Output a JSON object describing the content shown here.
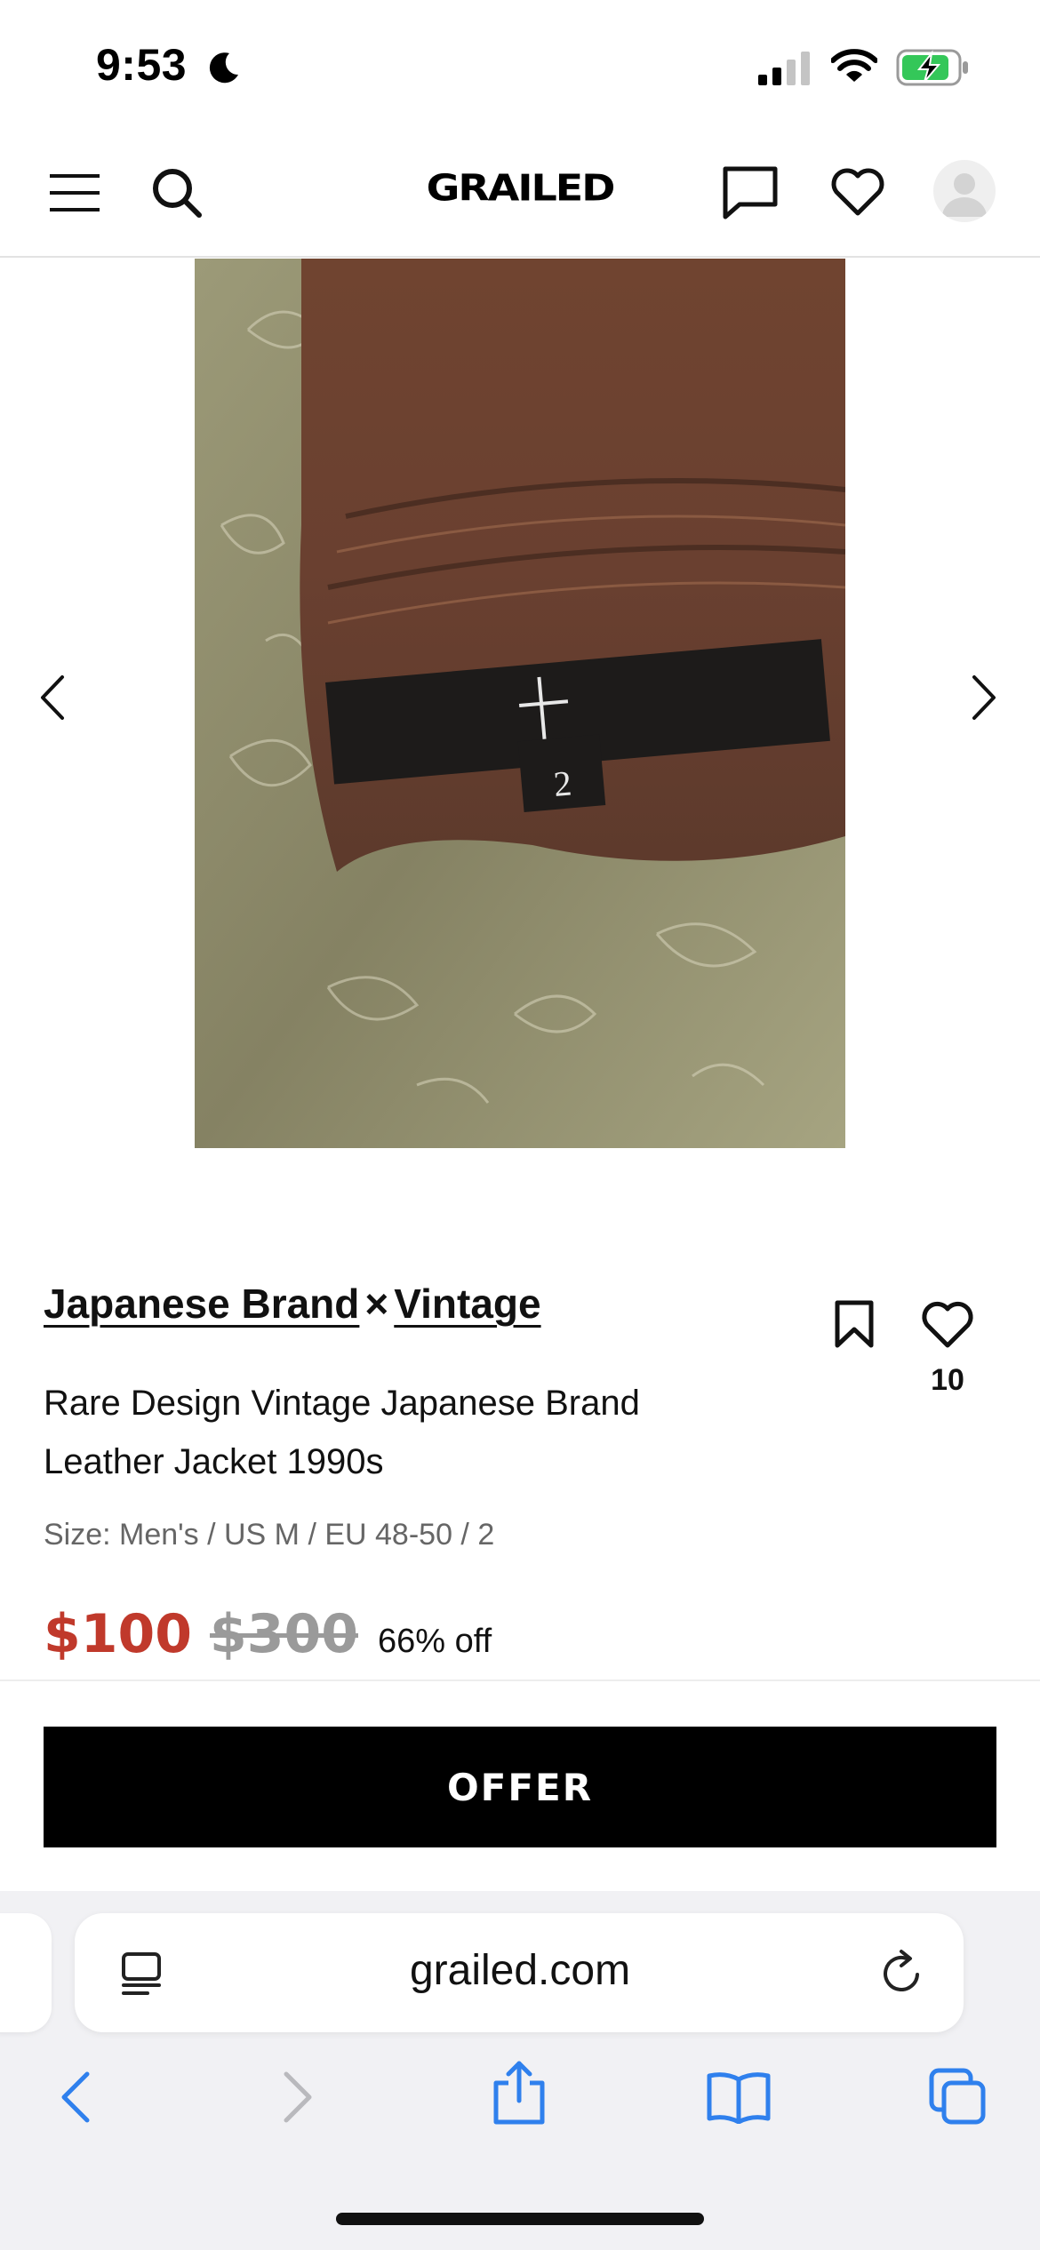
{
  "status_bar": {
    "time": "9:53",
    "icons": [
      "moon-icon",
      "cellular-signal-icon",
      "wifi-icon",
      "battery-charging-icon"
    ]
  },
  "header": {
    "logo": "GRAILED",
    "icons": [
      "menu-icon",
      "search-icon",
      "messages-icon",
      "favorites-heart-icon",
      "profile-avatar-icon"
    ]
  },
  "gallery": {
    "tag_number": "2",
    "icons": [
      "chevron-left-icon",
      "chevron-right-icon"
    ]
  },
  "product": {
    "brand_1": "Japanese Brand",
    "separator": "×",
    "brand_2": "Vintage",
    "title": "Rare Design Vintage Japanese Brand Leather Jacket 1990s",
    "size": "Size: Men's / US M / EU 48-50 / 2",
    "price": "$100",
    "original_price": "$300",
    "discount": "66% off",
    "like_count": "10",
    "icons": [
      "bookmark-icon",
      "heart-icon"
    ]
  },
  "cta": {
    "offer_label": "OFFER"
  },
  "browser": {
    "url": "grailed.com",
    "icons": [
      "reader-icon",
      "reload-icon",
      "back-icon",
      "forward-icon",
      "share-icon",
      "bookmarks-icon",
      "tabs-icon"
    ]
  },
  "colors": {
    "price_red": "#c0392b",
    "old_price_gray": "#9a9a9a",
    "safari_blue": "#2f80ed",
    "offer_black": "#000000"
  }
}
